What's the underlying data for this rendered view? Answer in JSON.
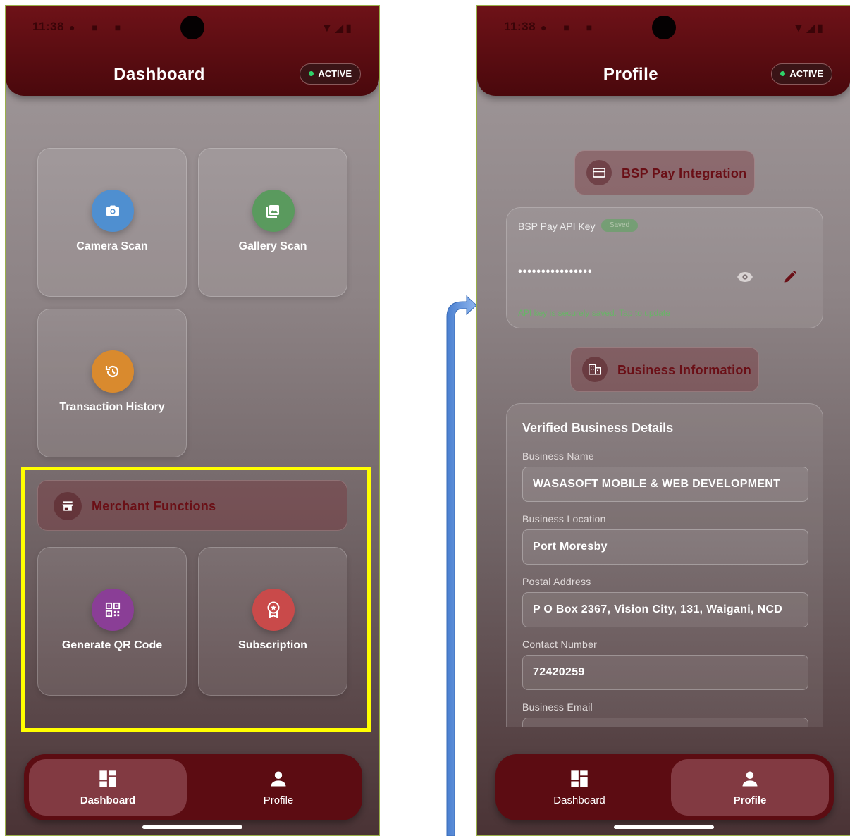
{
  "status_bar": {
    "time": "11:38"
  },
  "badge": {
    "label": "ACTIVE"
  },
  "dashboard": {
    "title": "Dashboard",
    "tiles": [
      {
        "label": "Camera Scan",
        "icon": "camera-icon",
        "color": "#4f8fd0"
      },
      {
        "label": "Gallery Scan",
        "icon": "gallery-icon",
        "color": "#5a9a5e"
      },
      {
        "label": "Transaction History",
        "icon": "history-icon",
        "color": "#d98a2e"
      }
    ],
    "merchant_section": {
      "label": "Merchant Functions",
      "icon": "store-icon"
    },
    "merchant_tiles": [
      {
        "label": "Generate QR Code",
        "icon": "qr-code-icon",
        "color": "#8a3e96"
      },
      {
        "label": "Subscription",
        "icon": "badge-icon",
        "color": "#c94a4a"
      }
    ]
  },
  "profile": {
    "title": "Profile",
    "bsp_section": {
      "label": "BSP Pay Integration",
      "icon": "card-icon"
    },
    "api_key": {
      "label": "BSP Pay API Key",
      "chip": "Saved",
      "value": "••••••••••••••••",
      "hint": "API key is securely saved. Tap to update"
    },
    "business_section": {
      "label": "Business Information",
      "icon": "building-icon"
    },
    "details": {
      "heading": "Verified Business Details",
      "fields": [
        {
          "label": "Business Name",
          "value": "WASASOFT MOBILE & WEB DEVELOPMENT"
        },
        {
          "label": "Business Location",
          "value": "Port Moresby"
        },
        {
          "label": "Postal Address",
          "value": "P O Box 2367, Vision City, 131, Waigani, NCD"
        },
        {
          "label": "Contact Number",
          "value": "72420259"
        },
        {
          "label": "Business Email",
          "value": ""
        }
      ]
    }
  },
  "nav": {
    "dashboard": "Dashboard",
    "profile": "Profile"
  },
  "colors": {
    "accent": "#5c0c12",
    "highlight": "#ffff00",
    "arrow": "#5b8ed6"
  }
}
